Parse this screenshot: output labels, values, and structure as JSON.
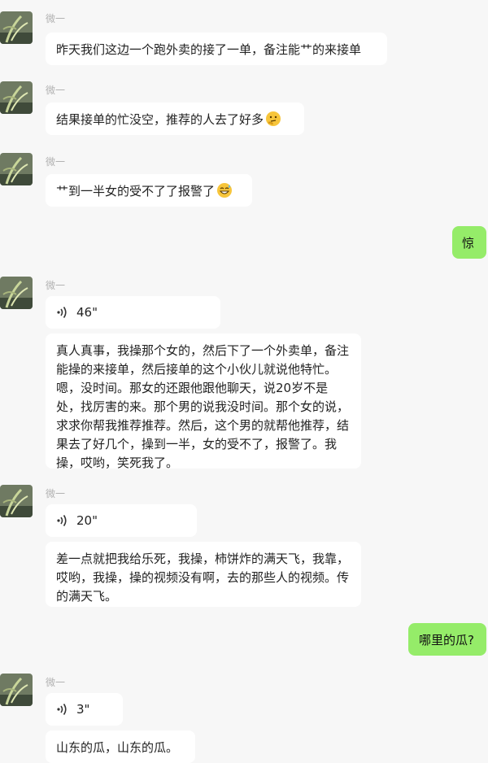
{
  "sender_name": "微一",
  "messages": [
    {
      "type": "text",
      "side": "in",
      "text": "昨天我们这边一个跑外卖的接了一单，备注能艹的来接单"
    },
    {
      "type": "text",
      "side": "in",
      "text": "结果接单的忙没空，推荐的人去了好多",
      "emoji": "thinking-face"
    },
    {
      "type": "text",
      "side": "in",
      "text": "艹到一半女的受不了了报警了",
      "emoji": "grinning-sweat-face"
    },
    {
      "type": "text",
      "side": "out",
      "text": "惊"
    },
    {
      "type": "voice",
      "side": "in",
      "duration": "46\""
    },
    {
      "type": "text",
      "side": "in",
      "text": "真人真事，我操那个女的，然后下了一个外卖单，备注能操的来接单，然后接单的这个小伙儿就说他特忙。嗯，没时间。那女的还跟他跟他聊天，说20岁不是处，找厉害的来。那个男的说我没时间。那个女的说，求求你帮我推荐推荐。然后，这个男的就帮他推荐，结果去了好几个，操到一半，女的受不了，报警了。我操，哎哟，笑死我了。"
    },
    {
      "type": "voice",
      "side": "in",
      "duration": "20\""
    },
    {
      "type": "text",
      "side": "in",
      "text": "差一点就把我给乐死，我操，柿饼炸的满天飞，我靠，哎哟，我操，操的视频没有啊，去的那些人的视频。传的满天飞。"
    },
    {
      "type": "text",
      "side": "out",
      "text": "哪里的瓜?"
    },
    {
      "type": "voice",
      "side": "in",
      "duration": "3\""
    },
    {
      "type": "text",
      "side": "in",
      "text": "山东的瓜，山东的瓜。"
    }
  ],
  "colors": {
    "outgoing_bubble": "#95ec69",
    "incoming_bubble": "#ffffff",
    "background": "#f7f7f7",
    "name_text": "#b2b2b2"
  }
}
